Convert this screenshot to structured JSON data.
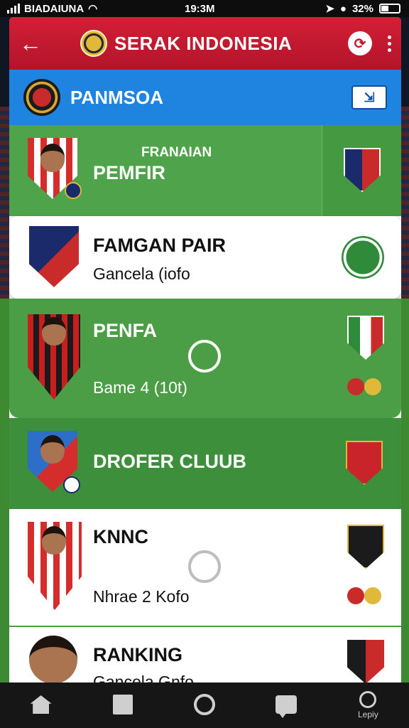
{
  "status_bar": {
    "carrier": "BIADAIUNA",
    "time": "19:3M",
    "battery": "32%"
  },
  "app_bar": {
    "back_icon": "arrow-left-icon",
    "title": "SERAK INDONESIA",
    "share_icon": "share-icon",
    "menu_icon": "more-vert-icon"
  },
  "team_header": {
    "title": "PANMSOA",
    "action_icon": "rank-icon"
  },
  "players": [
    {
      "supertitle": "FRANAIAN",
      "name": "PEMFIR",
      "info": ""
    },
    {
      "supertitle": "",
      "name": "FAMGAN PAIR",
      "info": "Gancela (iofo"
    },
    {
      "supertitle": "",
      "name": "PENFA",
      "info": "Bame 4 (10t)"
    },
    {
      "supertitle": "",
      "name": "DROFER CLUUB",
      "info": ""
    },
    {
      "supertitle": "",
      "name": "KNNC",
      "info": "Nhrae 2 Kofo"
    },
    {
      "supertitle": "",
      "name": "RANKING",
      "info": "Gancela Gnfo"
    }
  ],
  "bottom_nav": [
    {
      "icon": "home-icon",
      "label": ""
    },
    {
      "icon": "square-icon",
      "label": ""
    },
    {
      "icon": "circle-icon",
      "label": ""
    },
    {
      "icon": "chat-icon",
      "label": ""
    },
    {
      "icon": "profile-icon",
      "label": "Lepiy"
    }
  ],
  "colors": {
    "app_bar": "#c41a2e",
    "team_header": "#1e84e0",
    "row_green": "#4b9e45",
    "row_white": "#ffffff"
  }
}
